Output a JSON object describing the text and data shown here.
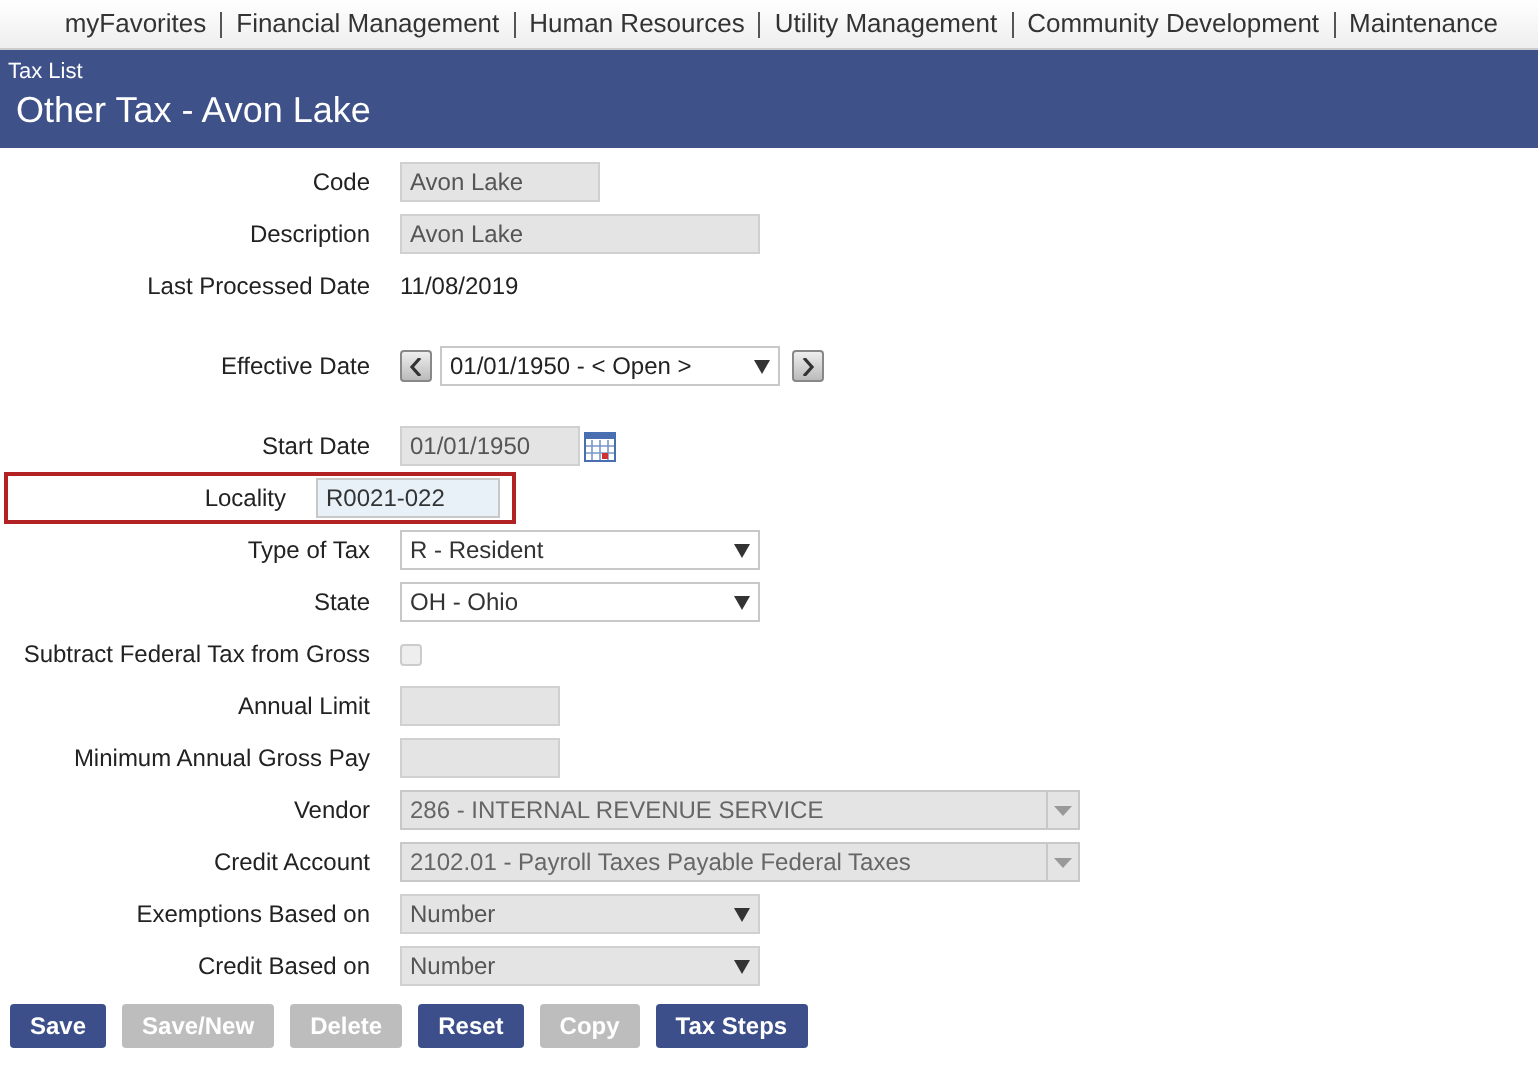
{
  "menu": [
    {
      "label": "myFavorites"
    },
    {
      "label": "Financial Management"
    },
    {
      "label": "Human Resources"
    },
    {
      "label": "Utility Management"
    },
    {
      "label": "Community Development"
    },
    {
      "label": "Maintenance"
    }
  ],
  "header": {
    "breadcrumb": "Tax List",
    "title": "Other Tax - Avon Lake"
  },
  "fields": [
    {
      "kind": "input",
      "label": "Code",
      "value": "Avon Lake",
      "disabled": true
    },
    {
      "kind": "input",
      "label": "Description",
      "value": "Avon Lake",
      "disabled": true
    },
    {
      "kind": "text",
      "label": "Last Processed Date",
      "value": "11/08/2019"
    },
    {
      "kind": "daterange",
      "label": "Effective Date",
      "value": "01/01/1950 - < Open >"
    },
    {
      "kind": "date",
      "label": "Start Date",
      "value": "01/01/1950",
      "disabled": true
    },
    {
      "kind": "input",
      "label": "Locality",
      "value": "R0021-022",
      "disabled": false,
      "highlighted": true
    },
    {
      "kind": "select",
      "label": "Type of Tax",
      "value": "R - Resident",
      "disabled": false
    },
    {
      "kind": "select",
      "label": "State",
      "value": "OH - Ohio",
      "disabled": false
    },
    {
      "kind": "checkbox",
      "label": "Subtract Federal Tax from Gross",
      "checked": false,
      "disabled": true
    },
    {
      "kind": "input",
      "label": "Annual Limit",
      "disabled": true
    },
    {
      "kind": "input",
      "label": "Minimum Annual Gross Pay",
      "disabled": true
    },
    {
      "kind": "combo",
      "label": "Vendor",
      "value": "286 - INTERNAL REVENUE SERVICE",
      "disabled": true
    },
    {
      "kind": "combo",
      "label": "Credit Account",
      "value": "2102.01 - Payroll Taxes Payable Federal Taxes",
      "disabled": true
    },
    {
      "kind": "select",
      "label": "Exemptions Based on",
      "value": "Number",
      "disabled": true
    },
    {
      "kind": "select",
      "label": "Credit Based on",
      "value": "Number",
      "disabled": true
    }
  ],
  "buttons": [
    {
      "label": "Save",
      "disabled": false
    },
    {
      "label": "Save/New",
      "disabled": true
    },
    {
      "label": "Delete",
      "disabled": true
    },
    {
      "label": "Reset",
      "disabled": false
    },
    {
      "label": "Copy",
      "disabled": true
    },
    {
      "label": "Tax Steps",
      "disabled": false
    }
  ]
}
